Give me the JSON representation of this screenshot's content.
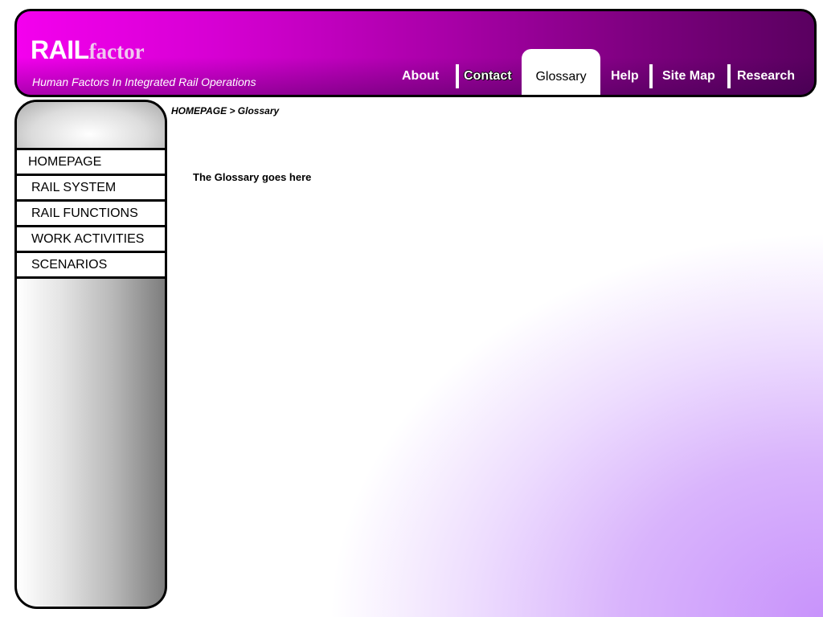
{
  "header": {
    "logo_primary": "RAIL",
    "logo_secondary": "factor",
    "tagline": "Human Factors In Integrated Rail Operations"
  },
  "nav": {
    "items": [
      {
        "label": "About",
        "active": false
      },
      {
        "label": "Contact",
        "active": false
      },
      {
        "label": "Glossary",
        "active": true
      },
      {
        "label": "Help",
        "active": false
      },
      {
        "label": "Site Map",
        "active": false
      },
      {
        "label": "Research",
        "active": false
      }
    ]
  },
  "sidebar": {
    "items": [
      {
        "label": "HOMEPAGE"
      },
      {
        "label": "RAIL SYSTEM"
      },
      {
        "label": "RAIL FUNCTIONS"
      },
      {
        "label": "WORK ACTIVITIES"
      },
      {
        "label": "SCENARIOS"
      }
    ]
  },
  "breadcrumb": "HOMEPAGE > Glossary",
  "content": {
    "text": "The Glossary goes here"
  },
  "colors": {
    "header_start": "#f400ee",
    "header_end": "#5a0060",
    "background_accent": "#c893fb"
  }
}
